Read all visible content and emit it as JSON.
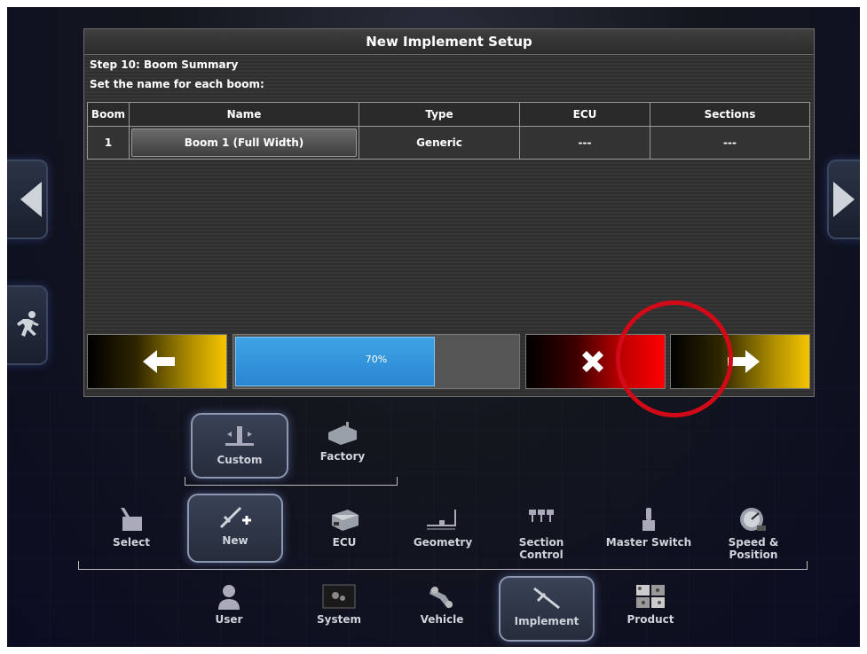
{
  "dialog": {
    "title": "New Implement Setup",
    "step": "Step 10: Boom Summary",
    "instruction": "Set the name for each boom:",
    "table": {
      "headers": [
        "Boom",
        "Name",
        "Type",
        "ECU",
        "Sections"
      ],
      "rows": [
        {
          "boom": "1",
          "name": "Boom 1 (Full Width)",
          "type": "Generic",
          "ecu": "---",
          "sections": "---"
        }
      ]
    },
    "progress": {
      "label": "70%",
      "value": 0.7
    },
    "buttons": {
      "back_icon": "arrow-left-icon",
      "cancel_icon": "x-icon",
      "next_icon": "arrow-right-icon"
    }
  },
  "sub_menu": [
    {
      "label": "Custom",
      "icon": "custom-boom-icon"
    },
    {
      "label": "Factory",
      "icon": "factory-icon"
    }
  ],
  "implement_menu": [
    {
      "label": "Select",
      "icon": "select-icon"
    },
    {
      "label": "New",
      "icon": "new-implement-icon"
    },
    {
      "label": "ECU",
      "icon": "ecu-icon"
    },
    {
      "label": "Geometry",
      "icon": "geometry-icon"
    },
    {
      "label": "Section Control",
      "icon": "section-control-icon"
    },
    {
      "label": "Master Switch",
      "icon": "master-switch-icon"
    },
    {
      "label": "Speed & Position",
      "icon": "speed-position-icon"
    }
  ],
  "main_menu": [
    {
      "label": "User",
      "icon": "user-icon"
    },
    {
      "label": "System",
      "icon": "system-icon"
    },
    {
      "label": "Vehicle",
      "icon": "vehicle-icon"
    },
    {
      "label": "Implement",
      "icon": "implement-icon"
    },
    {
      "label": "Product",
      "icon": "product-icon"
    }
  ],
  "colors": {
    "progress": "#2a86cf",
    "cancel": "#ff0000",
    "nav_accent": "#f5c400",
    "annotation": "#d20a18"
  }
}
